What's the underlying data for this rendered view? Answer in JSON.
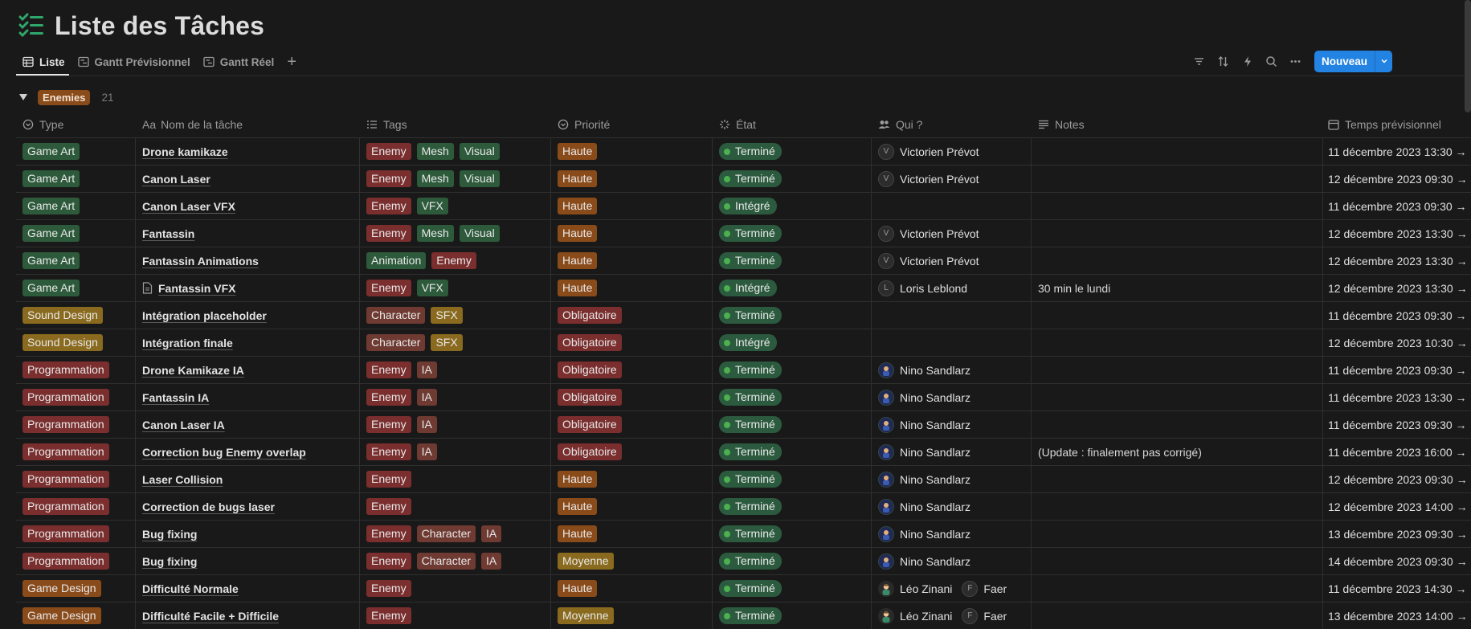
{
  "page": {
    "title": "Liste des Tâches"
  },
  "tabs": [
    {
      "label": "Liste"
    },
    {
      "label": "Gantt Prévisionnel"
    },
    {
      "label": "Gantt Réel"
    }
  ],
  "toolbar": {
    "new_label": "Nouveau"
  },
  "group": {
    "label": "Enemies",
    "count": "21"
  },
  "columns": [
    "Type",
    "Nom de la tâche",
    "Tags",
    "Priorité",
    "État",
    "Qui ?",
    "Notes",
    "Temps prévisionnel"
  ],
  "colors": {
    "Game Art": "#2d5a3b",
    "Sound Design": "#8a6a1e",
    "Programmation": "#7a2e2e",
    "Game Design": "#8a4b1a",
    "Enemy": "#7a2e2e",
    "Mesh": "#2d5a3b",
    "Visual": "#2d5a3b",
    "VFX": "#2d5a3b",
    "Animation": "#2d5a3b",
    "Character": "#6e3a32",
    "SFX": "#8a6a1e",
    "IA": "#6e3a32",
    "Haute": "#8a4b1a",
    "Obligatoire": "#7a2e2e",
    "Moyenne": "#8a6a1e",
    "accent": "#2383e2",
    "status_green": "#4caf50"
  },
  "rows": [
    {
      "type": "Game Art",
      "name": "Drone kamikaze",
      "tags": [
        "Enemy",
        "Mesh",
        "Visual"
      ],
      "priority": "Haute",
      "state": "Terminé",
      "people": [
        {
          "name": "Victorien Prévot",
          "initial": "V"
        }
      ],
      "notes": "",
      "date": "11 décembre 2023 13:30 →"
    },
    {
      "type": "Game Art",
      "name": "Canon Laser",
      "tags": [
        "Enemy",
        "Mesh",
        "Visual"
      ],
      "priority": "Haute",
      "state": "Terminé",
      "people": [
        {
          "name": "Victorien Prévot",
          "initial": "V"
        }
      ],
      "notes": "",
      "date": "12 décembre 2023 09:30 →"
    },
    {
      "type": "Game Art",
      "name": "Canon Laser VFX",
      "tags": [
        "Enemy",
        "VFX"
      ],
      "priority": "Haute",
      "state": "Intégré",
      "people": [],
      "notes": "",
      "date": "11 décembre 2023 09:30 →"
    },
    {
      "type": "Game Art",
      "name": "Fantassin",
      "tags": [
        "Enemy",
        "Mesh",
        "Visual"
      ],
      "priority": "Haute",
      "state": "Terminé",
      "people": [
        {
          "name": "Victorien Prévot",
          "initial": "V"
        }
      ],
      "notes": "",
      "date": "12 décembre 2023 13:30 →"
    },
    {
      "type": "Game Art",
      "name": "Fantassin Animations",
      "tags": [
        "Animation",
        "Enemy"
      ],
      "priority": "Haute",
      "state": "Terminé",
      "people": [
        {
          "name": "Victorien Prévot",
          "initial": "V"
        }
      ],
      "notes": "",
      "date": "12 décembre 2023 13:30 →"
    },
    {
      "type": "Game Art",
      "name": "Fantassin VFX",
      "doc": true,
      "tags": [
        "Enemy",
        "VFX"
      ],
      "priority": "Haute",
      "state": "Intégré",
      "people": [
        {
          "name": "Loris Leblond",
          "initial": "L"
        }
      ],
      "notes": "30 min le lundi",
      "date": "12 décembre 2023 13:30 →"
    },
    {
      "type": "Sound Design",
      "name": "Intégration placeholder",
      "tags": [
        "Character",
        "SFX"
      ],
      "priority": "Obligatoire",
      "state": "Terminé",
      "people": [],
      "notes": "",
      "date": "11 décembre 2023 09:30 →"
    },
    {
      "type": "Sound Design",
      "name": "Intégration finale",
      "tags": [
        "Character",
        "SFX"
      ],
      "priority": "Obligatoire",
      "state": "Intégré",
      "people": [],
      "notes": "",
      "date": "12 décembre 2023 10:30 →"
    },
    {
      "type": "Programmation",
      "name": "Drone Kamikaze IA",
      "tags": [
        "Enemy",
        "IA"
      ],
      "priority": "Obligatoire",
      "state": "Terminé",
      "people": [
        {
          "name": "Nino Sandlarz",
          "initial": "N",
          "kind": "nino"
        }
      ],
      "notes": "",
      "date": "11 décembre 2023 09:30 →"
    },
    {
      "type": "Programmation",
      "name": "Fantassin IA",
      "tags": [
        "Enemy",
        "IA"
      ],
      "priority": "Obligatoire",
      "state": "Terminé",
      "people": [
        {
          "name": "Nino Sandlarz",
          "initial": "N",
          "kind": "nino"
        }
      ],
      "notes": "",
      "date": "11 décembre 2023 13:30 →"
    },
    {
      "type": "Programmation",
      "name": "Canon Laser IA",
      "tags": [
        "Enemy",
        "IA"
      ],
      "priority": "Obligatoire",
      "state": "Terminé",
      "people": [
        {
          "name": "Nino Sandlarz",
          "initial": "N",
          "kind": "nino"
        }
      ],
      "notes": "",
      "date": "11 décembre 2023 09:30 →"
    },
    {
      "type": "Programmation",
      "name": "Correction bug Enemy overlap",
      "tags": [
        "Enemy",
        "IA"
      ],
      "priority": "Obligatoire",
      "state": "Terminé",
      "people": [
        {
          "name": "Nino Sandlarz",
          "initial": "N",
          "kind": "nino"
        }
      ],
      "notes": "(Update : finalement pas corrigé)",
      "date": "11 décembre 2023 16:00 →"
    },
    {
      "type": "Programmation",
      "name": "Laser Collision",
      "tags": [
        "Enemy"
      ],
      "priority": "Haute",
      "state": "Terminé",
      "people": [
        {
          "name": "Nino Sandlarz",
          "initial": "N",
          "kind": "nino"
        }
      ],
      "notes": "",
      "date": "12 décembre 2023 09:30 →"
    },
    {
      "type": "Programmation",
      "name": "Correction de bugs laser",
      "tags": [
        "Enemy"
      ],
      "priority": "Haute",
      "state": "Terminé",
      "people": [
        {
          "name": "Nino Sandlarz",
          "initial": "N",
          "kind": "nino"
        }
      ],
      "notes": "",
      "date": "12 décembre 2023 14:00 →"
    },
    {
      "type": "Programmation",
      "name": "Bug fixing",
      "tags": [
        "Enemy",
        "Character",
        "IA"
      ],
      "priority": "Haute",
      "state": "Terminé",
      "people": [
        {
          "name": "Nino Sandlarz",
          "initial": "N",
          "kind": "nino"
        }
      ],
      "notes": "",
      "date": "13 décembre 2023 09:30 →"
    },
    {
      "type": "Programmation",
      "name": "Bug fixing",
      "tags": [
        "Enemy",
        "Character",
        "IA"
      ],
      "priority": "Moyenne",
      "state": "Terminé",
      "people": [
        {
          "name": "Nino Sandlarz",
          "initial": "N",
          "kind": "nino"
        }
      ],
      "notes": "",
      "date": "14 décembre 2023 09:30 →"
    },
    {
      "type": "Game Design",
      "name": "Difficulté Normale",
      "tags": [
        "Enemy"
      ],
      "priority": "Haute",
      "state": "Terminé",
      "people": [
        {
          "name": "Léo Zinani",
          "initial": "L",
          "kind": "leo"
        },
        {
          "name": "Faer",
          "initial": "F"
        }
      ],
      "notes": "",
      "date": "11 décembre 2023 14:30 →"
    },
    {
      "type": "Game Design",
      "name": "Difficulté Facile + Difficile",
      "tags": [
        "Enemy"
      ],
      "priority": "Moyenne",
      "state": "Terminé",
      "people": [
        {
          "name": "Léo Zinani",
          "initial": "L",
          "kind": "leo"
        },
        {
          "name": "Faer",
          "initial": "F"
        }
      ],
      "notes": "",
      "date": "13 décembre 2023 14:00 →"
    }
  ]
}
